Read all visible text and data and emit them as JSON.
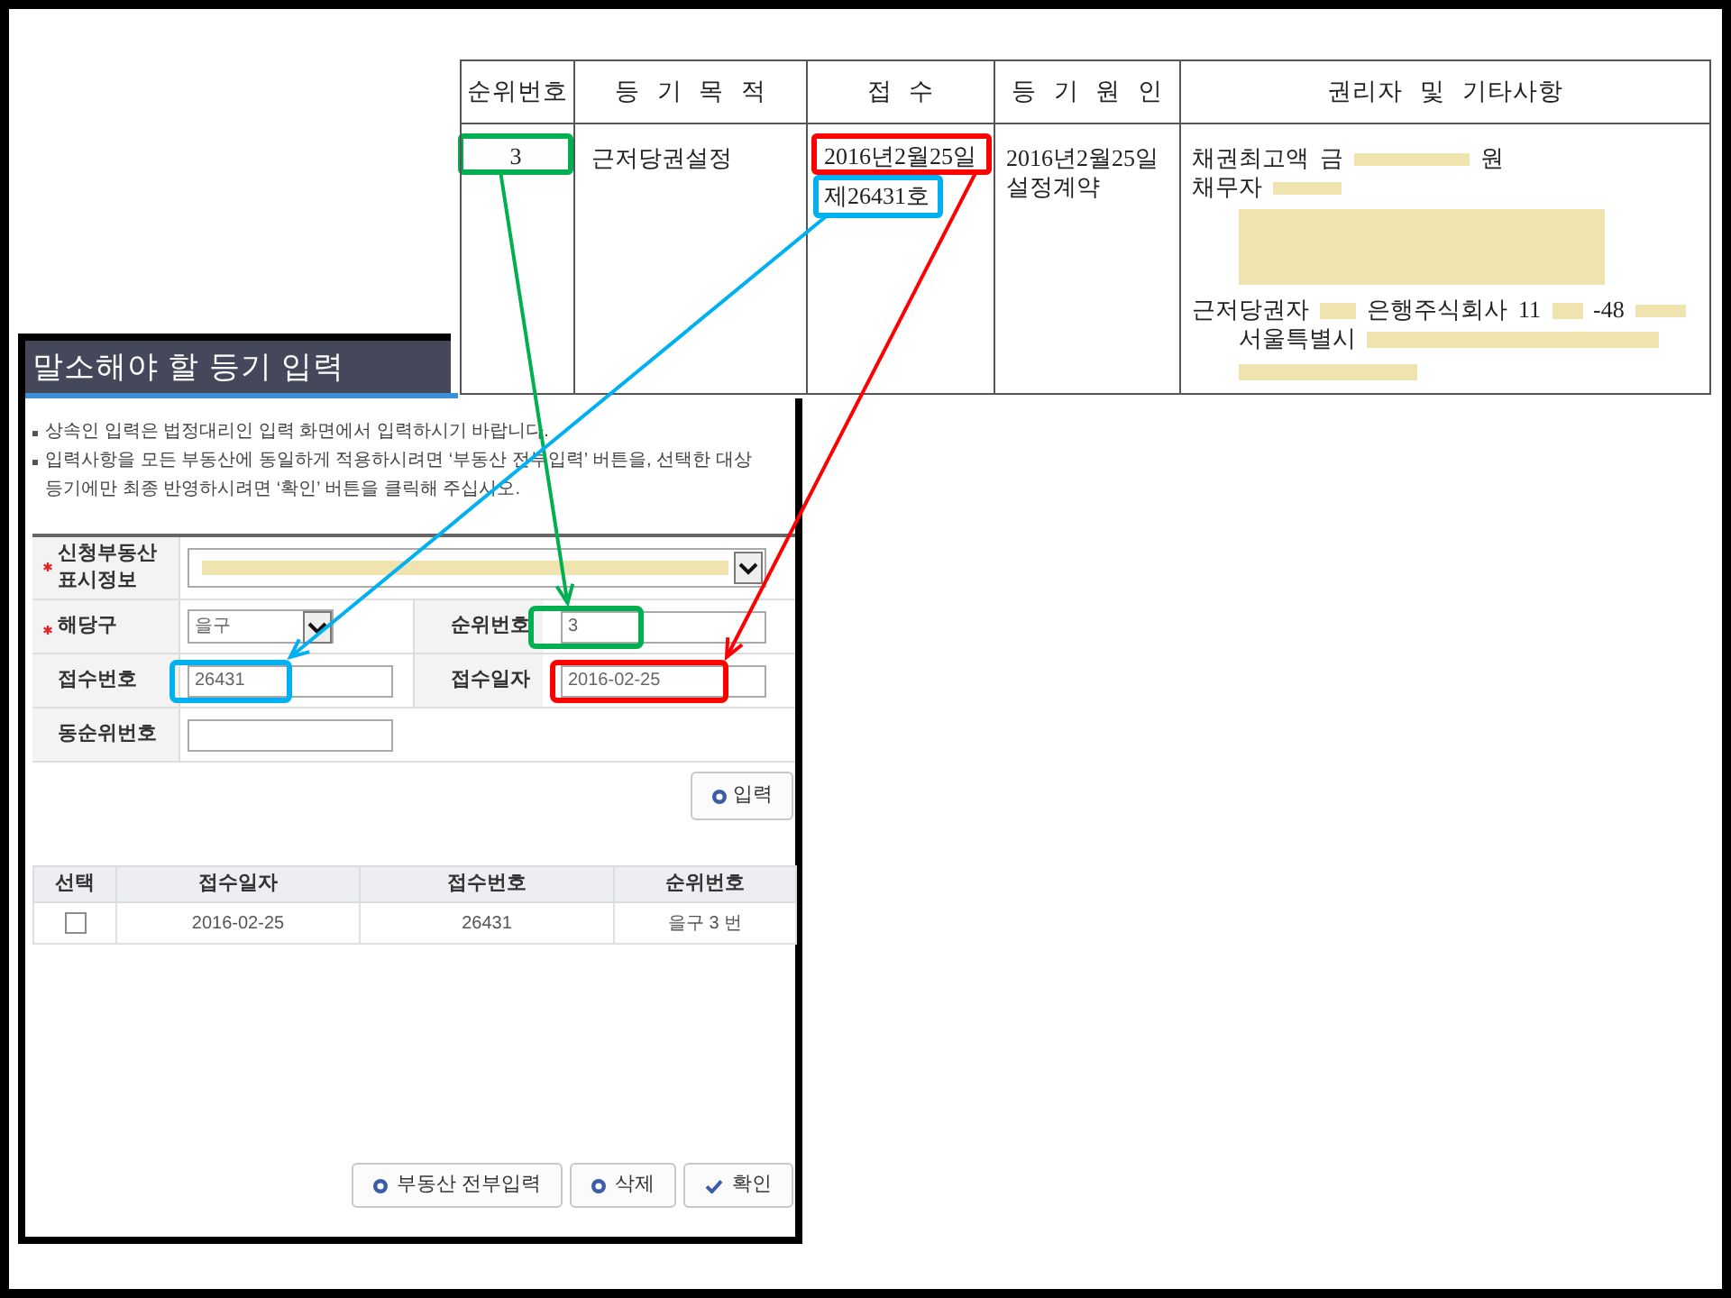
{
  "registry_table": {
    "columns": [
      "순위번호",
      "등 기 목 적",
      "접 수",
      "등 기 원 인",
      "권리자 및 기타사항"
    ],
    "row": {
      "rank": "3",
      "purpose": "근저당권설정",
      "receipt_date": "2016년2월25일",
      "receipt_number": "제26431호",
      "cause_date": "2016년2월25일",
      "cause": "설정계약",
      "rights_lines": [
        {
          "segments": [
            {
              "kind": "text",
              "text": "채권최고액"
            },
            {
              "kind": "text",
              "text": "금"
            },
            {
              "kind": "redacted"
            },
            {
              "kind": "text",
              "text": "원"
            }
          ]
        },
        {
          "segments": [
            {
              "kind": "text",
              "text": "채무자"
            },
            {
              "kind": "redacted"
            }
          ],
          "children": [
            {
              "segments": [
                {
                  "kind": "redacted"
                }
              ]
            }
          ]
        },
        {
          "segments": [
            {
              "kind": "text",
              "text": "근저당권자"
            },
            {
              "kind": "redacted"
            },
            {
              "kind": "text",
              "text": "은행주식회사"
            },
            {
              "kind": "text",
              "text": "11"
            },
            {
              "kind": "redacted"
            },
            {
              "kind": "text",
              "text": "-48"
            },
            {
              "kind": "redacted"
            }
          ],
          "children": [
            {
              "segments": [
                {
                  "kind": "text",
                  "text": "서울특별시"
                },
                {
                  "kind": "redacted"
                }
              ]
            },
            {
              "segments": [
                {
                  "kind": "redacted"
                }
              ]
            }
          ]
        }
      ]
    }
  },
  "form": {
    "title": "말소해야 할 등기 입력",
    "notes": [
      "상속인 입력은 법정대리인 입력 화면에서 입력하시기 바랍니다.",
      "입력사항을 모든 부동산에 동일하게 적용하시려면 ‘부동산 전부입력’ 버튼을, 선택한 대상 등기에만 최종 반영하시려면 ‘확인’ 버튼을 클릭해 주십시오."
    ],
    "rows": [
      [
        {
          "label": "신청부동산 표시정보",
          "required": true,
          "kind": "wide_select",
          "redacted": true
        }
      ],
      [
        {
          "label": "해당구",
          "required": true,
          "kind": "select",
          "redacted": false,
          "value": "을구"
        },
        {
          "label": "순위번호",
          "required": false,
          "kind": "text",
          "redacted": false,
          "value": "3"
        }
      ],
      [
        {
          "label": "접수번호",
          "required": false,
          "kind": "text",
          "redacted": false,
          "value": "26431"
        },
        {
          "label": "접수일자",
          "required": false,
          "kind": "text",
          "redacted": false,
          "value": "2016-02-25"
        }
      ],
      [
        {
          "label": "동순위번호",
          "required": false,
          "kind": "text",
          "redacted": false
        }
      ]
    ],
    "input_button": {
      "label": "입력",
      "kind": "ring"
    },
    "results": {
      "columns": [
        "선택",
        "접수일자",
        "접수번호",
        "순위번호"
      ],
      "rows": [
        {
          "cells": [
            {
              "kind": "checkbox",
              "checked": false
            },
            {
              "kind": "text",
              "text": "2016-02-25"
            },
            {
              "kind": "text",
              "text": "26431"
            },
            {
              "kind": "text",
              "text": "을구 3 번"
            }
          ]
        }
      ]
    },
    "buttons": [
      {
        "label": "부동산 전부입력",
        "kind": "ring"
      },
      {
        "label": "삭제",
        "kind": "ring"
      },
      {
        "label": "확인",
        "kind": "check"
      }
    ]
  },
  "annotations": [
    {
      "color": "#00b050"
    },
    {
      "color": "#00b0f0"
    },
    {
      "color": "#ff0000"
    }
  ]
}
